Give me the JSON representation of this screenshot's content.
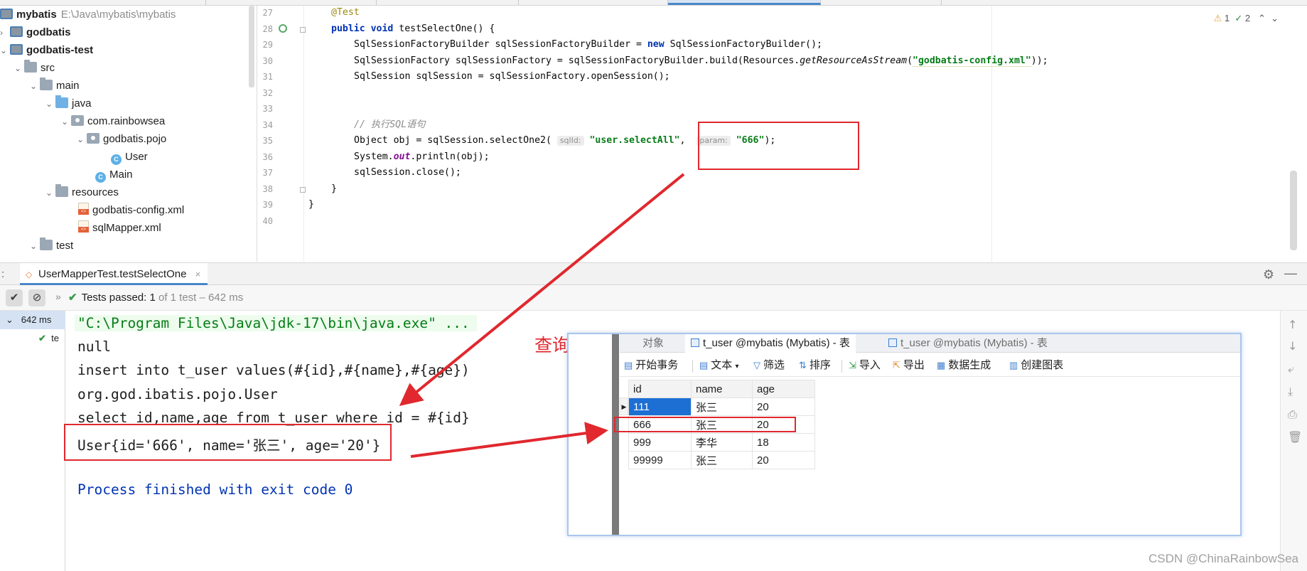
{
  "project_tree": {
    "root_label": "mybatis",
    "root_path": "E:\\Java\\mybatis\\mybatis",
    "items": [
      {
        "label": "godbatis"
      },
      {
        "label": "godbatis-test"
      },
      {
        "label": "src"
      },
      {
        "label": "main"
      },
      {
        "label": "java"
      },
      {
        "label": "com.rainbowsea"
      },
      {
        "label": "godbatis.pojo"
      },
      {
        "label": "User"
      },
      {
        "label": "Main"
      },
      {
        "label": "resources"
      },
      {
        "label": "godbatis-config.xml"
      },
      {
        "label": "sqlMapper.xml"
      },
      {
        "label": "test"
      }
    ]
  },
  "editor": {
    "line_numbers": [
      "27",
      "28",
      "29",
      "30",
      "31",
      "32",
      "33",
      "34",
      "35",
      "36",
      "37",
      "38",
      "39",
      "40"
    ],
    "inspections": {
      "warnings": "1",
      "weak_warnings": "2"
    },
    "code": {
      "l27_ann": "@Test",
      "l28_kw1": "public",
      "l28_kw2": "void",
      "l28_rest": " testSelectOne() {",
      "l29_a": "SqlSessionFactoryBuilder sqlSessionFactoryBuilder = ",
      "l29_new": "new",
      "l29_b": " SqlSessionFactoryBuilder();",
      "l30_a": "SqlSessionFactory sqlSessionFactory = sqlSessionFactoryBuilder.build(Resources.",
      "l30_method": "getResourceAsStream",
      "l30_paren": "(",
      "l30_str": "\"godbatis-config.xml\"",
      "l30_end": "));",
      "l31": "SqlSession sqlSession = sqlSessionFactory.openSession();",
      "l34_comment": "// 执行SQL语句",
      "l35_a": "Object obj = sqlSession.selectOne2( ",
      "l35_hint1": "sqlId:",
      "l35_str1": "\"user.selectAll\"",
      "l35_comma": ",  ",
      "l35_hint2": "param:",
      "l35_str2": "\"666\"",
      "l35_end": ");",
      "l36_a": "System.",
      "l36_field": "out",
      "l36_b": ".println(obj);",
      "l37": "sqlSession.close();",
      "l38": "}",
      "l39": "}"
    }
  },
  "run_window": {
    "colon": ":",
    "tab_label": "UserMapperTest.testSelectOne",
    "tab_close": "×",
    "toolbar": {
      "sep": "»",
      "passed_label": "Tests passed: ",
      "passed_count": "1",
      "passed_detail": "of 1 test – 642 ms"
    },
    "test_tree": {
      "root_time": "642 ms",
      "child_label": "te"
    },
    "console_lines": {
      "cmd": "\"C:\\Program Files\\Java\\jdk-17\\bin\\java.exe\" ...",
      "l1": "null",
      "l2": "insert into t_user values(#{id},#{name},#{age})",
      "l3": "org.god.ibatis.pojo.User",
      "l4": "select id,name,age from t_user where id = #{id}",
      "l5": "User{id='666', name='张三', age='20'}",
      "exit": "Process finished with exit code 0"
    }
  },
  "annotation": {
    "query_ok": "查询成功"
  },
  "navicat": {
    "tabs": [
      "对象",
      "t_user @mybatis (Mybatis) - 表",
      "t_user @mybatis (Mybatis) - 表"
    ],
    "toolbar": [
      "开始事务",
      "文本",
      "筛选",
      "排序",
      "导入",
      "导出",
      "数据生成",
      "创建图表"
    ],
    "columns": [
      "id",
      "name",
      "age"
    ],
    "rows": [
      {
        "id": "111",
        "name": "张三",
        "age": "20"
      },
      {
        "id": "666",
        "name": "张三",
        "age": "20"
      },
      {
        "id": "999",
        "name": "李华",
        "age": "18"
      },
      {
        "id": "99999",
        "name": "张三",
        "age": "20"
      }
    ],
    "row_marker": "▶"
  },
  "watermark": "CSDN @ChinaRainbowSea",
  "colors": {
    "accent": "#4a86c8",
    "annotation_red": "#e0282e",
    "string_green": "#067d17",
    "keyword_blue": "#0033b3",
    "pass_green": "#3a9a4a"
  }
}
